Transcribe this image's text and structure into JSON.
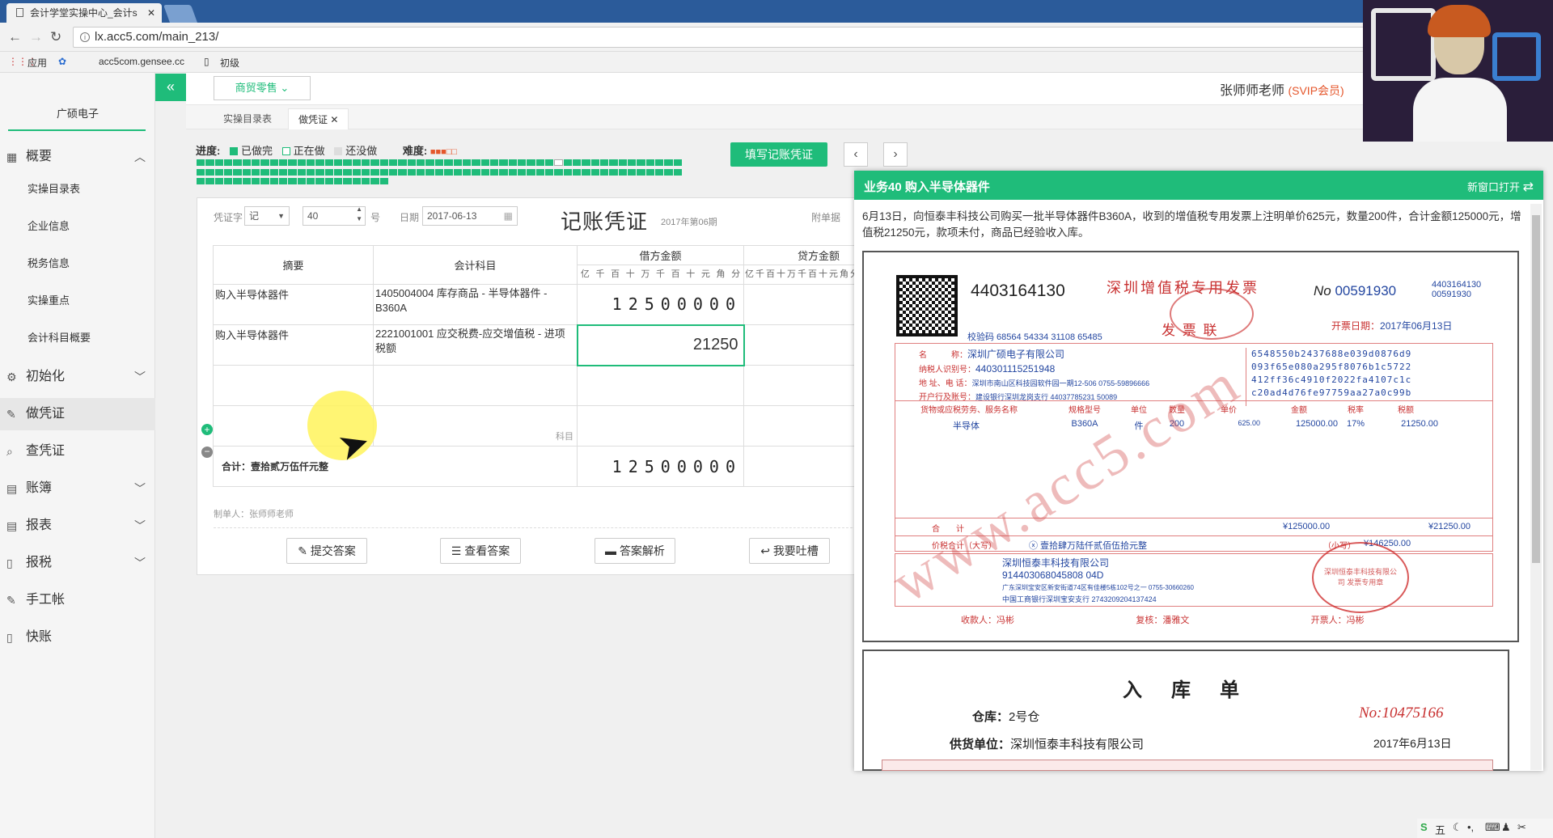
{
  "browser": {
    "tab_title": "会计学堂实操中心_会计s",
    "url": "lx.acc5.com/main_213/",
    "bookmarks": [
      "应用",
      "acc5com.gensee.cc",
      "初级"
    ]
  },
  "sidebar": {
    "company": "广硕电子",
    "items": [
      {
        "label": "概要",
        "icon": "grid-icon"
      },
      {
        "label": "初始化",
        "icon": "gear-icon"
      },
      {
        "label": "做凭证",
        "icon": "pencil-icon"
      },
      {
        "label": "查凭证",
        "icon": "search-icon"
      },
      {
        "label": "账簿",
        "icon": "book-icon"
      },
      {
        "label": "报表",
        "icon": "report-icon"
      },
      {
        "label": "报税",
        "icon": "doc-icon"
      },
      {
        "label": "手工帐",
        "icon": "pen-icon"
      },
      {
        "label": "快账",
        "icon": "doc-icon"
      }
    ],
    "sub_items": [
      "实操目录表",
      "企业信息",
      "税务信息",
      "实操重点",
      "会计科目概要"
    ]
  },
  "header": {
    "collapse": "«",
    "mode_select": "商贸零售",
    "user_name": "张师师老师",
    "user_level": "(SVIP会员)"
  },
  "tabs": [
    "实操目录表",
    "做凭证"
  ],
  "progress": {
    "label": "进度:",
    "done": "已做完",
    "doing": "正在做",
    "todo": "还没做",
    "difficulty_label": "难度:",
    "difficulty": "■■■□□"
  },
  "actions": {
    "fill_voucher": "填写记账凭证",
    "prev": "‹",
    "next": "›"
  },
  "voucher": {
    "word_label": "凭证字",
    "word": "记",
    "number": "40",
    "number_suffix": "号",
    "date_label": "日期",
    "date": "2017-06-13",
    "title": "记账凭证",
    "period": "2017年第06期",
    "attach_label": "附单据",
    "col_summary": "摘要",
    "col_account": "会计科目",
    "col_debit": "借方金额",
    "col_credit": "贷方金额",
    "units": [
      "亿",
      "千",
      "百",
      "十",
      "万",
      "千",
      "百",
      "十",
      "元",
      "角",
      "分"
    ],
    "rows": [
      {
        "summary": "购入半导体器件",
        "account": "1405004004 库存商品 - 半导体器件 - B360A",
        "debit": "12500000"
      },
      {
        "summary": "购入半导体器件",
        "account": "2221001001 应交税费-应交增值税 - 进项税额",
        "debit": "21250"
      }
    ],
    "account_placeholder": "科目",
    "total_label": "合计：壹拾贰万伍仟元整",
    "total": "12500000",
    "maker": "制单人：张师师老师"
  },
  "buttons": {
    "submit": "提交答案",
    "view": "查看答案",
    "analysis": "答案解析",
    "feedback": "我要吐槽"
  },
  "panel": {
    "title": "业务40 购入半导体器件",
    "open_new": "新窗口打开",
    "description": "6月13日，向恒泰丰科技公司购买一批半导体器件B360A，收到的增值税专用发票上注明单价625元，数量200件，合计金额125000元，增值税21250元，款项未付，商品已经验收入库。"
  },
  "invoice": {
    "code": "4403164130",
    "title": "深圳增值税专用发票",
    "subtitle": "发 票 联",
    "no_label": "No",
    "no": "00591930",
    "code_small": "4403164130",
    "no_small": "00591930",
    "date_label": "开票日期：",
    "date": "2017年06月13日",
    "check_code": "校验码 68564 54334 31108 65485",
    "buyer_name_label": "名　　　称：",
    "buyer_name": "深圳广硕电子有限公司",
    "buyer_tax_label": "纳税人识别号：",
    "buyer_tax": "440301115251948",
    "buyer_addr_label": "地 址、电 话：",
    "buyer_addr": "深圳市南山区科技园软件园一期12-506 0755-59896666",
    "buyer_bank_label": "开户行及账号：",
    "buyer_bank": "建设银行深圳龙岗支行 44037785231 50089",
    "cipher": [
      "6548550b2437688e039d0876d9",
      "093f65e080a295f8076b1c5722",
      "412ff36c4910f2022fa4107c1c",
      "c20ad4d76fe97759aa27a0c99b"
    ],
    "col_goods": "货物或应税劳务、服务名称",
    "col_spec": "规格型号",
    "col_unit": "单位",
    "col_qty": "数量",
    "col_price": "单价",
    "col_amount": "金额",
    "col_rate": "税率",
    "col_tax": "税额",
    "item_name": "半导体",
    "item_spec": "B360A",
    "item_unit": "件",
    "item_qty": "200",
    "item_price": "625.00",
    "item_amount": "125000.00",
    "item_rate": "17%",
    "item_tax": "21250.00",
    "sum_label": "合　　计",
    "sum_amount": "¥125000.00",
    "sum_tax": "¥21250.00",
    "total_label": "价税合计（大写）",
    "total_words": "ⓧ 壹拾肆万陆仟贰佰伍拾元整",
    "total_small_label": "（小写）",
    "total_small": "¥146250.00",
    "seller_name": "深圳恒泰丰科技有限公司",
    "seller_tax": "914403068045808 04D",
    "seller_addr": "广东深圳宝安区新安街道74区有佳楼5栋102号之一 0755-30660260",
    "seller_bank": "中国工商银行深圳宝安支行 2743209204137424",
    "payee": "收款人：冯彬",
    "reviewer": "复核：潘雅文",
    "drawer": "开票人：冯彬",
    "seller_seal": "深圳恒泰丰科技有限公司 发票专用章",
    "watermark": "www.acc5.com"
  },
  "receipt": {
    "title": "入　库　单",
    "warehouse_label": "仓库：",
    "warehouse": "2号仓",
    "no": "No:10475166",
    "supplier_label": "供货单位：",
    "supplier": "深圳恒泰丰科技有限公司",
    "date": "2017年6月13日"
  },
  "taskbar": {
    "ime": "五"
  }
}
